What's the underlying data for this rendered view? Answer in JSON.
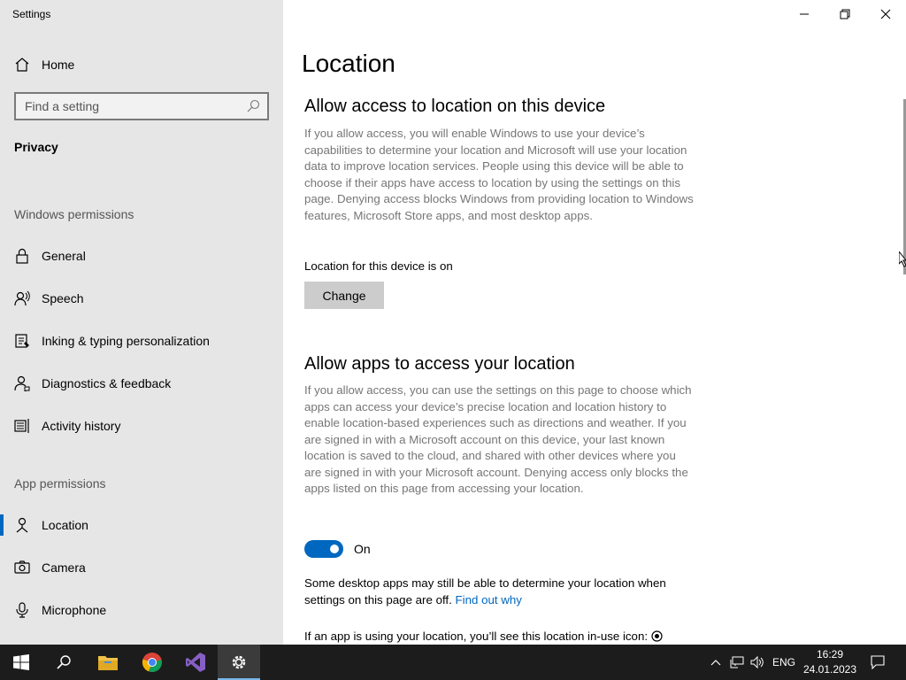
{
  "window": {
    "title": "Settings",
    "minimize_icon": "minimize-icon",
    "restore_icon": "restore-icon",
    "close_icon": "close-icon"
  },
  "sidebar": {
    "home_label": "Home",
    "search_placeholder": "Find a setting",
    "section_title": "Privacy",
    "windows_permissions_label": "Windows permissions",
    "windows_items": [
      {
        "label": "General",
        "icon": "lock-icon"
      },
      {
        "label": "Speech",
        "icon": "speech-icon"
      },
      {
        "label": "Inking & typing personalization",
        "icon": "inking-icon"
      },
      {
        "label": "Diagnostics & feedback",
        "icon": "feedback-icon"
      },
      {
        "label": "Activity history",
        "icon": "activity-icon"
      }
    ],
    "app_permissions_label": "App permissions",
    "app_items": [
      {
        "label": "Location",
        "icon": "location-icon",
        "active": true
      },
      {
        "label": "Camera",
        "icon": "camera-icon"
      },
      {
        "label": "Microphone",
        "icon": "microphone-icon"
      }
    ]
  },
  "main": {
    "title": "Location",
    "section1": {
      "heading": "Allow access to location on this device",
      "description": "If you allow access, you will enable Windows to use your device’s capabilities to determine your location and Microsoft will use your location data to improve location services. People using this device will be able to choose if their apps have access to location by using the settings on this page. Denying access blocks Windows from providing location to Windows features, Microsoft Store apps, and most desktop apps.",
      "status": "Location for this device is on",
      "change_button": "Change"
    },
    "section2": {
      "heading": "Allow apps to access your location",
      "description": "If you allow access, you can use the settings on this page to choose which apps can access your device’s precise location and location history to enable location-based experiences such as directions and weather. If you are signed in with a Microsoft account on this device, your last known location is saved to the cloud, and shared with other devices where you are signed in with your Microsoft account. Denying access only blocks the apps listed on this page from accessing your location.",
      "toggle_state": "On",
      "note_text": "Some desktop apps may still be able to determine your location when settings on this page are off.",
      "note_link": "Find out why",
      "inuse_text": "If an app is using your location, you’ll see this location in-use icon:"
    }
  },
  "taskbar": {
    "apps": [
      {
        "name": "start",
        "icon": "windows-start-icon"
      },
      {
        "name": "search",
        "icon": "search-icon"
      },
      {
        "name": "file-explorer",
        "icon": "folder-icon"
      },
      {
        "name": "chrome",
        "icon": "chrome-icon"
      },
      {
        "name": "visual-studio",
        "icon": "visual-studio-icon"
      },
      {
        "name": "settings",
        "icon": "gear-icon",
        "active": true
      }
    ],
    "language": "ENG",
    "time": "16:29",
    "date": "24.01.2023"
  },
  "colors": {
    "accent": "#0067c0",
    "sidebar_bg": "#e6e6e6",
    "taskbar_bg": "#1c1c1c"
  }
}
